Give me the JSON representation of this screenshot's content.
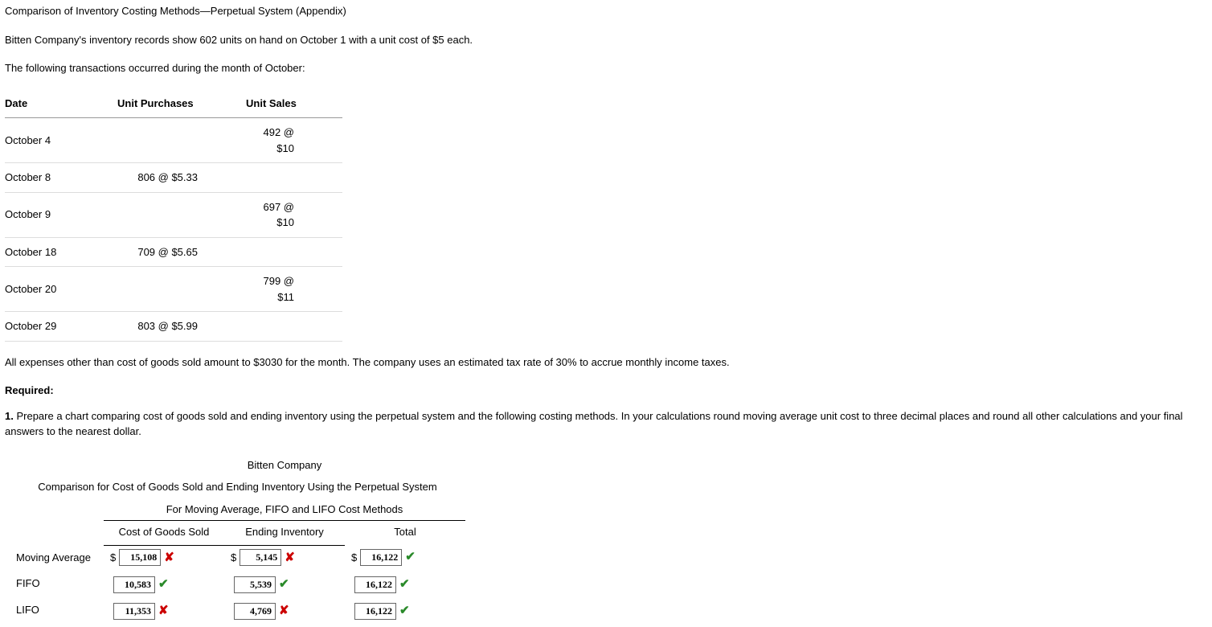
{
  "title": "Comparison of Inventory Costing Methods—Perpetual System (Appendix)",
  "intro1": "Bitten Company's inventory records show 602 units on hand on October 1 with a unit cost of $5 each.",
  "intro2": "The following transactions occurred during the month of October:",
  "trans_headers": {
    "date": "Date",
    "purchases": "Unit Purchases",
    "sales": "Unit Sales"
  },
  "transactions": [
    {
      "date": "October 4",
      "purchases": "",
      "sales": "492 @ $10"
    },
    {
      "date": "October 8",
      "purchases": "806 @ $5.33",
      "sales": ""
    },
    {
      "date": "October 9",
      "purchases": "",
      "sales": "697 @ $10"
    },
    {
      "date": "October 18",
      "purchases": "709 @ $5.65",
      "sales": ""
    },
    {
      "date": "October 20",
      "purchases": "",
      "sales": "799 @ $11"
    },
    {
      "date": "October 29",
      "purchases": "803 @ $5.99",
      "sales": ""
    }
  ],
  "intro3": "All expenses other than cost of goods sold amount to $3030 for the month. The company uses an estimated tax rate of 30% to accrue monthly income taxes.",
  "required_label": "Required:",
  "q1_num": "1.",
  "q1_text": "Prepare a chart comparing cost of goods sold and ending inventory using the perpetual system and the following costing methods. In your calculations round moving average unit cost to three decimal places and round all other calculations and your final answers to the nearest dollar.",
  "answer": {
    "title1": "Bitten Company",
    "title2": "Comparison for Cost of Goods Sold and Ending Inventory Using the Perpetual System",
    "title3": "For Moving Average, FIFO and LIFO Cost Methods",
    "headers": {
      "cogs": "Cost of Goods Sold",
      "ending": "Ending Inventory",
      "total": "Total"
    },
    "rows": [
      {
        "label": "Moving Average",
        "cogs": {
          "dollar": "$",
          "value": "15,108",
          "correct": false
        },
        "ending": {
          "dollar": "$",
          "value": "5,145",
          "correct": false
        },
        "total": {
          "dollar": "$",
          "value": "16,122",
          "correct": true
        }
      },
      {
        "label": "FIFO",
        "cogs": {
          "dollar": "",
          "value": "10,583",
          "correct": true
        },
        "ending": {
          "dollar": "",
          "value": "5,539",
          "correct": true
        },
        "total": {
          "dollar": "",
          "value": "16,122",
          "correct": true
        }
      },
      {
        "label": "LIFO",
        "cogs": {
          "dollar": "",
          "value": "11,353",
          "correct": false
        },
        "ending": {
          "dollar": "",
          "value": "4,769",
          "correct": false
        },
        "total": {
          "dollar": "",
          "value": "16,122",
          "correct": true
        }
      }
    ]
  },
  "marks": {
    "correct": "✔",
    "incorrect": "✘"
  }
}
